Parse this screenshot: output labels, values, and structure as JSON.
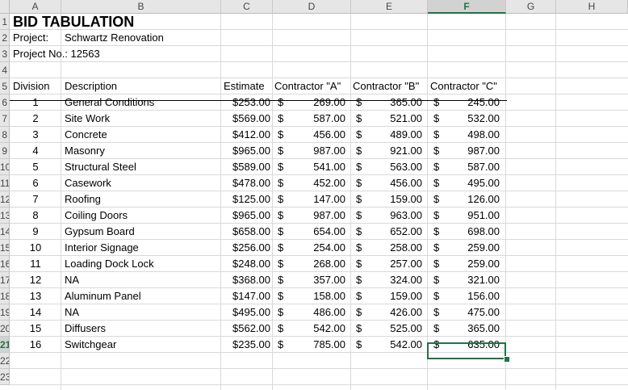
{
  "columns": [
    "A",
    "B",
    "C",
    "D",
    "E",
    "F",
    "G",
    "H"
  ],
  "selected_column": "F",
  "row_numbers": [
    "1",
    "2",
    "3",
    "4",
    "5",
    "6",
    "7",
    "8",
    "9",
    "10",
    "11",
    "12",
    "13",
    "14",
    "15",
    "16",
    "17",
    "18",
    "19",
    "20",
    "21",
    "22",
    "23"
  ],
  "selected_row": "21",
  "sheet": {
    "title": "BID TABULATION",
    "project_label": "Project:",
    "project_name": "Schwartz Renovation",
    "project_no": "Project No.: 12563",
    "headers": {
      "division": "Division",
      "description": "Description",
      "estimate": "Estimate",
      "contractor_a": "Contractor \"A\"",
      "contractor_b": "Contractor \"B\"",
      "contractor_c": "Contractor \"C\""
    },
    "currency_symbol": "$",
    "rows": [
      {
        "division": "1",
        "description": "General Conditions",
        "estimate": "$253.00",
        "a": "269.00",
        "b": "365.00",
        "c": "245.00"
      },
      {
        "division": "2",
        "description": "Site Work",
        "estimate": "$569.00",
        "a": "587.00",
        "b": "521.00",
        "c": "532.00"
      },
      {
        "division": "3",
        "description": "Concrete",
        "estimate": "$412.00",
        "a": "456.00",
        "b": "489.00",
        "c": "498.00"
      },
      {
        "division": "4",
        "description": "Masonry",
        "estimate": "$965.00",
        "a": "987.00",
        "b": "921.00",
        "c": "987.00"
      },
      {
        "division": "5",
        "description": "Structural Steel",
        "estimate": "$589.00",
        "a": "541.00",
        "b": "563.00",
        "c": "587.00"
      },
      {
        "division": "6",
        "description": "Casework",
        "estimate": "$478.00",
        "a": "452.00",
        "b": "456.00",
        "c": "495.00"
      },
      {
        "division": "7",
        "description": "Roofing",
        "estimate": "$125.00",
        "a": "147.00",
        "b": "159.00",
        "c": "126.00"
      },
      {
        "division": "8",
        "description": "Coiling Doors",
        "estimate": "$965.00",
        "a": "987.00",
        "b": "963.00",
        "c": "951.00"
      },
      {
        "division": "9",
        "description": "Gypsum Board",
        "estimate": "$658.00",
        "a": "654.00",
        "b": "652.00",
        "c": "698.00"
      },
      {
        "division": "10",
        "description": "Interior Signage",
        "estimate": "$256.00",
        "a": "254.00",
        "b": "258.00",
        "c": "259.00"
      },
      {
        "division": "11",
        "description": "Loading Dock Lock",
        "estimate": "$248.00",
        "a": "268.00",
        "b": "257.00",
        "c": "259.00"
      },
      {
        "division": "12",
        "description": "NA",
        "estimate": "$368.00",
        "a": "357.00",
        "b": "324.00",
        "c": "321.00"
      },
      {
        "division": "13",
        "description": "Aluminum Panel",
        "estimate": "$147.00",
        "a": "158.00",
        "b": "159.00",
        "c": "156.00"
      },
      {
        "division": "14",
        "description": "NA",
        "estimate": "$495.00",
        "a": "486.00",
        "b": "426.00",
        "c": "475.00"
      },
      {
        "division": "15",
        "description": "Diffusers",
        "estimate": "$562.00",
        "a": "542.00",
        "b": "525.00",
        "c": "365.00"
      },
      {
        "division": "16",
        "description": "Switchgear",
        "estimate": "$235.00",
        "a": "785.00",
        "b": "542.00",
        "c": "635.00"
      }
    ]
  }
}
